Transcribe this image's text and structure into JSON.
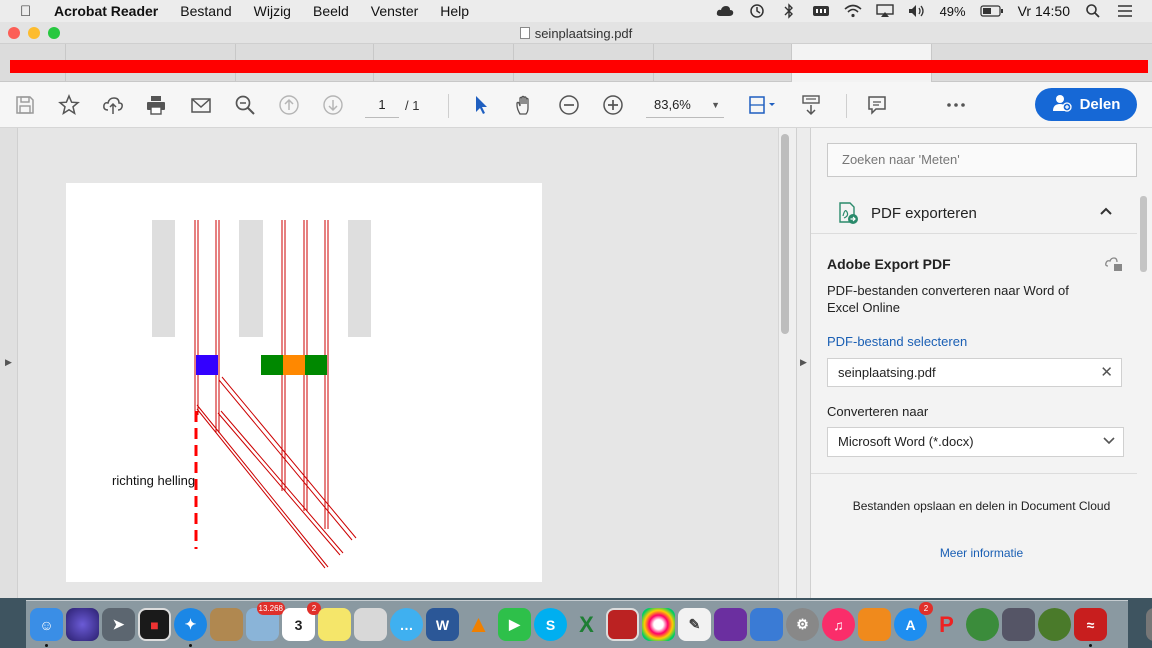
{
  "menubar": {
    "app_name": "Acrobat Reader",
    "items": [
      "Bestand",
      "Wijzig",
      "Beeld",
      "Venster",
      "Help"
    ],
    "battery": "49%",
    "clock": "Vr 14:50"
  },
  "window": {
    "title": "seinplaatsing.pdf"
  },
  "toolbar": {
    "page_current": "1",
    "page_total": "/ 1",
    "zoom": "83,6%",
    "share_label": "Delen"
  },
  "document": {
    "annotation": "richting helling"
  },
  "panel": {
    "search_placeholder": "Zoeken naar 'Meten'",
    "section_title": "PDF exporteren",
    "card_title": "Adobe Export PDF",
    "card_description": "PDF-bestanden converteren naar Word of Excel Online",
    "select_link": "PDF-bestand selecteren",
    "selected_file": "seinplaatsing.pdf",
    "convert_label": "Converteren naar",
    "convert_value": "Microsoft Word (*.docx)",
    "dc_text": "Bestanden opslaan en delen in Document Cloud",
    "more_info": "Meer informatie"
  },
  "dock": {
    "badges": {
      "photos": "13.268",
      "calendar": "2",
      "appstore": "2"
    },
    "calendar_day": "3"
  },
  "colors": {
    "accent_blue": "#1668d6",
    "redaction_bar": "#ff0000",
    "track_red": "#cc0000",
    "signal_blue": "#3300ff",
    "signal_green": "#008800",
    "signal_orange": "#ff8800"
  }
}
